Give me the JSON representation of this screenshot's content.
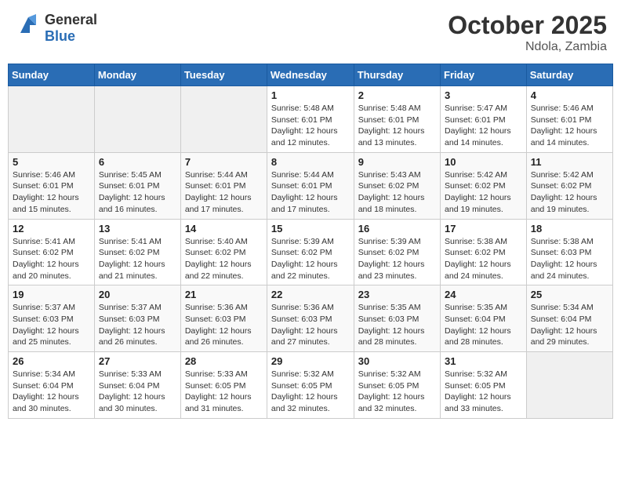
{
  "header": {
    "logo_general": "General",
    "logo_blue": "Blue",
    "month_title": "October 2025",
    "location": "Ndola, Zambia"
  },
  "weekdays": [
    "Sunday",
    "Monday",
    "Tuesday",
    "Wednesday",
    "Thursday",
    "Friday",
    "Saturday"
  ],
  "weeks": [
    [
      {
        "day": "",
        "info": ""
      },
      {
        "day": "",
        "info": ""
      },
      {
        "day": "",
        "info": ""
      },
      {
        "day": "1",
        "info": "Sunrise: 5:48 AM\nSunset: 6:01 PM\nDaylight: 12 hours\nand 12 minutes."
      },
      {
        "day": "2",
        "info": "Sunrise: 5:48 AM\nSunset: 6:01 PM\nDaylight: 12 hours\nand 13 minutes."
      },
      {
        "day": "3",
        "info": "Sunrise: 5:47 AM\nSunset: 6:01 PM\nDaylight: 12 hours\nand 14 minutes."
      },
      {
        "day": "4",
        "info": "Sunrise: 5:46 AM\nSunset: 6:01 PM\nDaylight: 12 hours\nand 14 minutes."
      }
    ],
    [
      {
        "day": "5",
        "info": "Sunrise: 5:46 AM\nSunset: 6:01 PM\nDaylight: 12 hours\nand 15 minutes."
      },
      {
        "day": "6",
        "info": "Sunrise: 5:45 AM\nSunset: 6:01 PM\nDaylight: 12 hours\nand 16 minutes."
      },
      {
        "day": "7",
        "info": "Sunrise: 5:44 AM\nSunset: 6:01 PM\nDaylight: 12 hours\nand 17 minutes."
      },
      {
        "day": "8",
        "info": "Sunrise: 5:44 AM\nSunset: 6:01 PM\nDaylight: 12 hours\nand 17 minutes."
      },
      {
        "day": "9",
        "info": "Sunrise: 5:43 AM\nSunset: 6:02 PM\nDaylight: 12 hours\nand 18 minutes."
      },
      {
        "day": "10",
        "info": "Sunrise: 5:42 AM\nSunset: 6:02 PM\nDaylight: 12 hours\nand 19 minutes."
      },
      {
        "day": "11",
        "info": "Sunrise: 5:42 AM\nSunset: 6:02 PM\nDaylight: 12 hours\nand 19 minutes."
      }
    ],
    [
      {
        "day": "12",
        "info": "Sunrise: 5:41 AM\nSunset: 6:02 PM\nDaylight: 12 hours\nand 20 minutes."
      },
      {
        "day": "13",
        "info": "Sunrise: 5:41 AM\nSunset: 6:02 PM\nDaylight: 12 hours\nand 21 minutes."
      },
      {
        "day": "14",
        "info": "Sunrise: 5:40 AM\nSunset: 6:02 PM\nDaylight: 12 hours\nand 22 minutes."
      },
      {
        "day": "15",
        "info": "Sunrise: 5:39 AM\nSunset: 6:02 PM\nDaylight: 12 hours\nand 22 minutes."
      },
      {
        "day": "16",
        "info": "Sunrise: 5:39 AM\nSunset: 6:02 PM\nDaylight: 12 hours\nand 23 minutes."
      },
      {
        "day": "17",
        "info": "Sunrise: 5:38 AM\nSunset: 6:02 PM\nDaylight: 12 hours\nand 24 minutes."
      },
      {
        "day": "18",
        "info": "Sunrise: 5:38 AM\nSunset: 6:03 PM\nDaylight: 12 hours\nand 24 minutes."
      }
    ],
    [
      {
        "day": "19",
        "info": "Sunrise: 5:37 AM\nSunset: 6:03 PM\nDaylight: 12 hours\nand 25 minutes."
      },
      {
        "day": "20",
        "info": "Sunrise: 5:37 AM\nSunset: 6:03 PM\nDaylight: 12 hours\nand 26 minutes."
      },
      {
        "day": "21",
        "info": "Sunrise: 5:36 AM\nSunset: 6:03 PM\nDaylight: 12 hours\nand 26 minutes."
      },
      {
        "day": "22",
        "info": "Sunrise: 5:36 AM\nSunset: 6:03 PM\nDaylight: 12 hours\nand 27 minutes."
      },
      {
        "day": "23",
        "info": "Sunrise: 5:35 AM\nSunset: 6:03 PM\nDaylight: 12 hours\nand 28 minutes."
      },
      {
        "day": "24",
        "info": "Sunrise: 5:35 AM\nSunset: 6:04 PM\nDaylight: 12 hours\nand 28 minutes."
      },
      {
        "day": "25",
        "info": "Sunrise: 5:34 AM\nSunset: 6:04 PM\nDaylight: 12 hours\nand 29 minutes."
      }
    ],
    [
      {
        "day": "26",
        "info": "Sunrise: 5:34 AM\nSunset: 6:04 PM\nDaylight: 12 hours\nand 30 minutes."
      },
      {
        "day": "27",
        "info": "Sunrise: 5:33 AM\nSunset: 6:04 PM\nDaylight: 12 hours\nand 30 minutes."
      },
      {
        "day": "28",
        "info": "Sunrise: 5:33 AM\nSunset: 6:05 PM\nDaylight: 12 hours\nand 31 minutes."
      },
      {
        "day": "29",
        "info": "Sunrise: 5:32 AM\nSunset: 6:05 PM\nDaylight: 12 hours\nand 32 minutes."
      },
      {
        "day": "30",
        "info": "Sunrise: 5:32 AM\nSunset: 6:05 PM\nDaylight: 12 hours\nand 32 minutes."
      },
      {
        "day": "31",
        "info": "Sunrise: 5:32 AM\nSunset: 6:05 PM\nDaylight: 12 hours\nand 33 minutes."
      },
      {
        "day": "",
        "info": ""
      }
    ]
  ]
}
